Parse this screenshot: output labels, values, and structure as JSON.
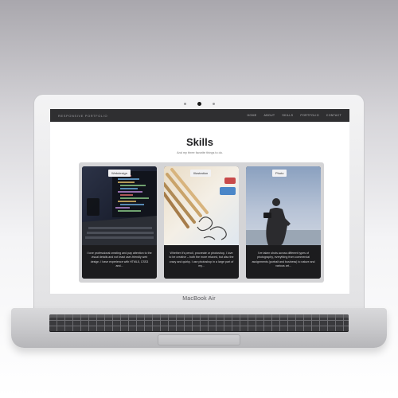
{
  "device": {
    "brand_label": "MacBook Air"
  },
  "site": {
    "name": "Responsive portfolio",
    "nav": [
      "Home",
      "About",
      "Skills",
      "Portfolio",
      "Contact"
    ],
    "title": "Skills",
    "subtitle": "And my three favorite things to do.",
    "cards": [
      {
        "tag": "Webdesign",
        "text": "I love professional creating and pay attention to the visual details and not least user-friendly web design. I have experience with HTML5, CSS3 and..."
      },
      {
        "tag": "Illustration",
        "text": "Whether it's pencil, procreate or photoshop, I love to be creative – both the more relaxed, but also the crazy and quirky. I use photoshop in a large part of my..."
      },
      {
        "tag": "Photo",
        "text": "I've taken shots across different types of photography, everything from commercial assignments (portrait and business) to nature and various art..."
      }
    ]
  },
  "colors": {
    "navbar": "#2f2f31",
    "card_text_bg": "#1c1c1e"
  }
}
